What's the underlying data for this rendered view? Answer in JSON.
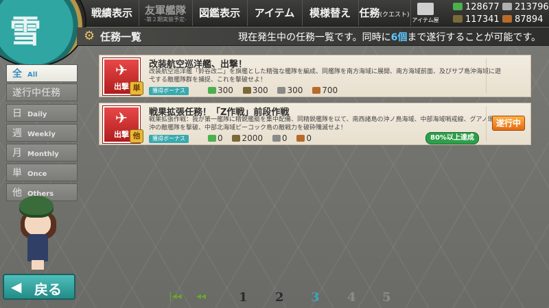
{
  "emblem": {
    "char": "雪"
  },
  "menu": {
    "record": "戦績表示",
    "fleet": "友軍艦隊",
    "fleet_sub": "-第２期実装予定-",
    "encyclopedia": "図鑑表示",
    "item": "アイテム",
    "decor": "模様替え",
    "quest": "任務",
    "quest_small": "(クエスト)",
    "item_shop": "アイテム屋"
  },
  "resources": {
    "fuel": "128677",
    "steel": "213796",
    "ammo": "117341",
    "bauxite": "87894"
  },
  "title": {
    "label": "任務一覧",
    "info_prefix": "現在発生中の任務一覧です。同時に",
    "info_num": "6個",
    "info_suffix": "まで遂行することが可能です。"
  },
  "tabs": [
    {
      "jp": "全",
      "en": "All",
      "active": true
    },
    {
      "jp": "遂行中任務",
      "en": "",
      "active": false
    },
    {
      "jp": "日",
      "en": "Daily",
      "active": false
    },
    {
      "jp": "週",
      "en": "Weekly",
      "active": false
    },
    {
      "jp": "月",
      "en": "Monthly",
      "active": false
    },
    {
      "jp": "単",
      "en": "Once",
      "active": false
    },
    {
      "jp": "他",
      "en": "Others",
      "active": false
    }
  ],
  "quests": [
    {
      "category": "出撃",
      "type": "単",
      "title": "改装航空巡洋艦、出撃！",
      "desc": "改装航空巡洋艦「鈴谷改二」を旗艦とした精強な艦隊を編成、同艦隊を南方海域に展開、南方海域前面、及びサブ島沖海域に遊弋する敵艦隊群を捕捉、これを撃破せよ！",
      "bonus": "獲得ボーナス",
      "fuel": "300",
      "ammo": "300",
      "steel": "300",
      "bauxite": "700",
      "status": ""
    },
    {
      "category": "出撃",
      "type": "他",
      "title": "戦果拡張任務！「Z作戦」前段作戦",
      "desc": "戦果拡張作戦：我が第一艦隊に精鋭艦艇を集中配備、同精鋭艦隊を以て、南西諸島の沖ノ鳥海域、中部海域哨戒線、グアノ環礁沖の敵艦隊を撃破、中部北海域ピーコック島の敵戦力を破砕殲滅せよ！",
      "bonus": "獲得ボーナス",
      "fuel": "0",
      "ammo": "2000",
      "steel": "0",
      "bauxite": "0",
      "status": "遂行中",
      "progress": "80%以上達成"
    }
  ],
  "back": {
    "label": "戻る"
  },
  "pagination": {
    "pages": [
      "1",
      "2",
      "3",
      "4",
      "5"
    ],
    "current": "3"
  },
  "colors": {
    "accent": "#3aa8b8",
    "quest_badge": "#c62828",
    "status": "#ef7a1a",
    "progress": "#2f9e4a",
    "fuel": "#4caf50",
    "ammo": "#7a6a3a",
    "steel": "#b0b0b0",
    "bauxite": "#b86a2a"
  },
  "icons": {
    "gear": "gear-icon",
    "plane": "plane-icon",
    "back": "arrow-left-icon",
    "first_page": "first-page-icon",
    "prev_page": "prev-page-icon"
  }
}
